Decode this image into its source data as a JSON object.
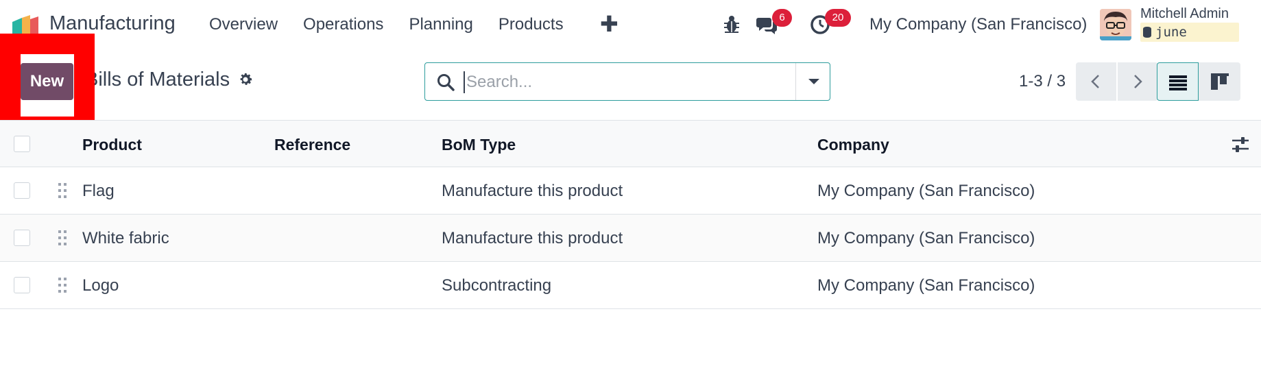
{
  "navbar": {
    "app_name": "Manufacturing",
    "menu": [
      "Overview",
      "Operations",
      "Planning",
      "Products"
    ],
    "plus": "✚",
    "messages_badge": "6",
    "activities_badge": "20",
    "company": "My Company (San Francisco)",
    "user_name": "Mitchell Admin",
    "database": "june"
  },
  "control": {
    "new_label": "New",
    "title": "Bills of Materials",
    "search_placeholder": "Search...",
    "pager": "1-3 / 3"
  },
  "list": {
    "columns": [
      "Product",
      "Reference",
      "BoM Type",
      "Company"
    ],
    "rows": [
      {
        "product": "Flag",
        "reference": "",
        "type": "Manufacture this product",
        "company": "My Company (San Francisco)"
      },
      {
        "product": "White fabric",
        "reference": "",
        "type": "Manufacture this product",
        "company": "My Company (San Francisco)"
      },
      {
        "product": "Logo",
        "reference": "",
        "type": "Subcontracting",
        "company": "My Company (San Francisco)"
      }
    ]
  },
  "colors": {
    "primary": "#714b67",
    "accent": "#2c9c9c",
    "badge": "#dc1f3a",
    "highlight": "#ff0000"
  }
}
